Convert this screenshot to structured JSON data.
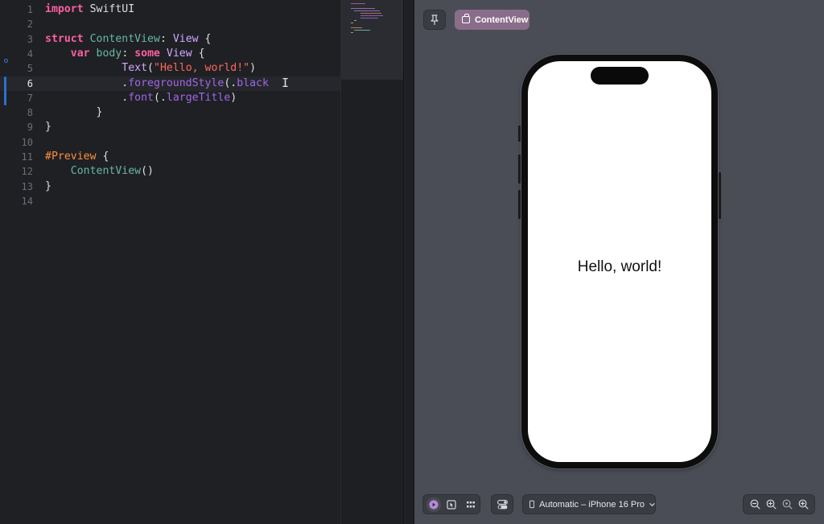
{
  "editor": {
    "lines": [
      {
        "num": "1",
        "tokens": [
          {
            "c": "kw",
            "t": "import"
          },
          {
            "c": "plain",
            "t": " SwiftUI"
          }
        ]
      },
      {
        "num": "2",
        "tokens": []
      },
      {
        "num": "3",
        "tokens": [
          {
            "c": "kw",
            "t": "struct"
          },
          {
            "c": "plain",
            "t": " "
          },
          {
            "c": "pf",
            "t": "ContentView"
          },
          {
            "c": "plain",
            "t": ": "
          },
          {
            "c": "ty",
            "t": "View"
          },
          {
            "c": "plain",
            "t": " {"
          }
        ]
      },
      {
        "num": "4",
        "tokens": [
          {
            "c": "plain",
            "t": "    "
          },
          {
            "c": "kw",
            "t": "var"
          },
          {
            "c": "plain",
            "t": " "
          },
          {
            "c": "pf",
            "t": "body"
          },
          {
            "c": "plain",
            "t": ": "
          },
          {
            "c": "kw",
            "t": "some"
          },
          {
            "c": "plain",
            "t": " "
          },
          {
            "c": "ty",
            "t": "View"
          },
          {
            "c": "plain",
            "t": " {"
          }
        ]
      },
      {
        "num": "5",
        "tokens": [
          {
            "c": "plain",
            "t": "            "
          },
          {
            "c": "ty",
            "t": "Text"
          },
          {
            "c": "plain",
            "t": "("
          },
          {
            "c": "str",
            "t": "\"Hello, world!\""
          },
          {
            "c": "plain",
            "t": ")"
          }
        ]
      },
      {
        "num": "6",
        "tokens": [
          {
            "c": "plain",
            "t": "            ."
          },
          {
            "c": "fn",
            "t": "foregroundStyle"
          },
          {
            "c": "plain",
            "t": "(."
          },
          {
            "c": "fn",
            "t": "black"
          }
        ]
      },
      {
        "num": "7",
        "tokens": [
          {
            "c": "plain",
            "t": "            ."
          },
          {
            "c": "fn",
            "t": "font"
          },
          {
            "c": "plain",
            "t": "(."
          },
          {
            "c": "fn",
            "t": "largeTitle"
          },
          {
            "c": "plain",
            "t": ")"
          }
        ]
      },
      {
        "num": "8",
        "tokens": [
          {
            "c": "plain",
            "t": "        }"
          }
        ]
      },
      {
        "num": "9",
        "tokens": [
          {
            "c": "plain",
            "t": "}"
          }
        ]
      },
      {
        "num": "10",
        "tokens": []
      },
      {
        "num": "11",
        "tokens": [
          {
            "c": "mac",
            "t": "#Preview"
          },
          {
            "c": "plain",
            "t": " {"
          }
        ]
      },
      {
        "num": "12",
        "tokens": [
          {
            "c": "plain",
            "t": "    "
          },
          {
            "c": "pf",
            "t": "ContentView"
          },
          {
            "c": "plain",
            "t": "()"
          }
        ]
      },
      {
        "num": "13",
        "tokens": [
          {
            "c": "plain",
            "t": "}"
          }
        ]
      },
      {
        "num": "14",
        "tokens": []
      }
    ],
    "current_line": 6
  },
  "preview": {
    "pin_icon": "pin-icon",
    "content_view_chip": "ContentView",
    "hello_text": "Hello, world!",
    "device_selector": "Automatic – iPhone 16 Pro",
    "live_icon": "live-preview-icon",
    "select_icon": "selectable-icon",
    "variants_icon": "variants-icon",
    "settings_icon": "device-settings-icon",
    "zoom_icons": [
      "zoom-out-icon",
      "zoom-to-fit-icon",
      "zoom-100-icon",
      "zoom-in-icon"
    ]
  },
  "colors": {
    "keyword": "#fc5fa3",
    "type": "#d0a8ff",
    "project_name": "#67b7a4",
    "string": "#fc6a5d",
    "method": "#a167e6",
    "macro": "#fd8f3f",
    "chip_accent": "#8a6d8a",
    "canvas": "#4a4d55"
  }
}
